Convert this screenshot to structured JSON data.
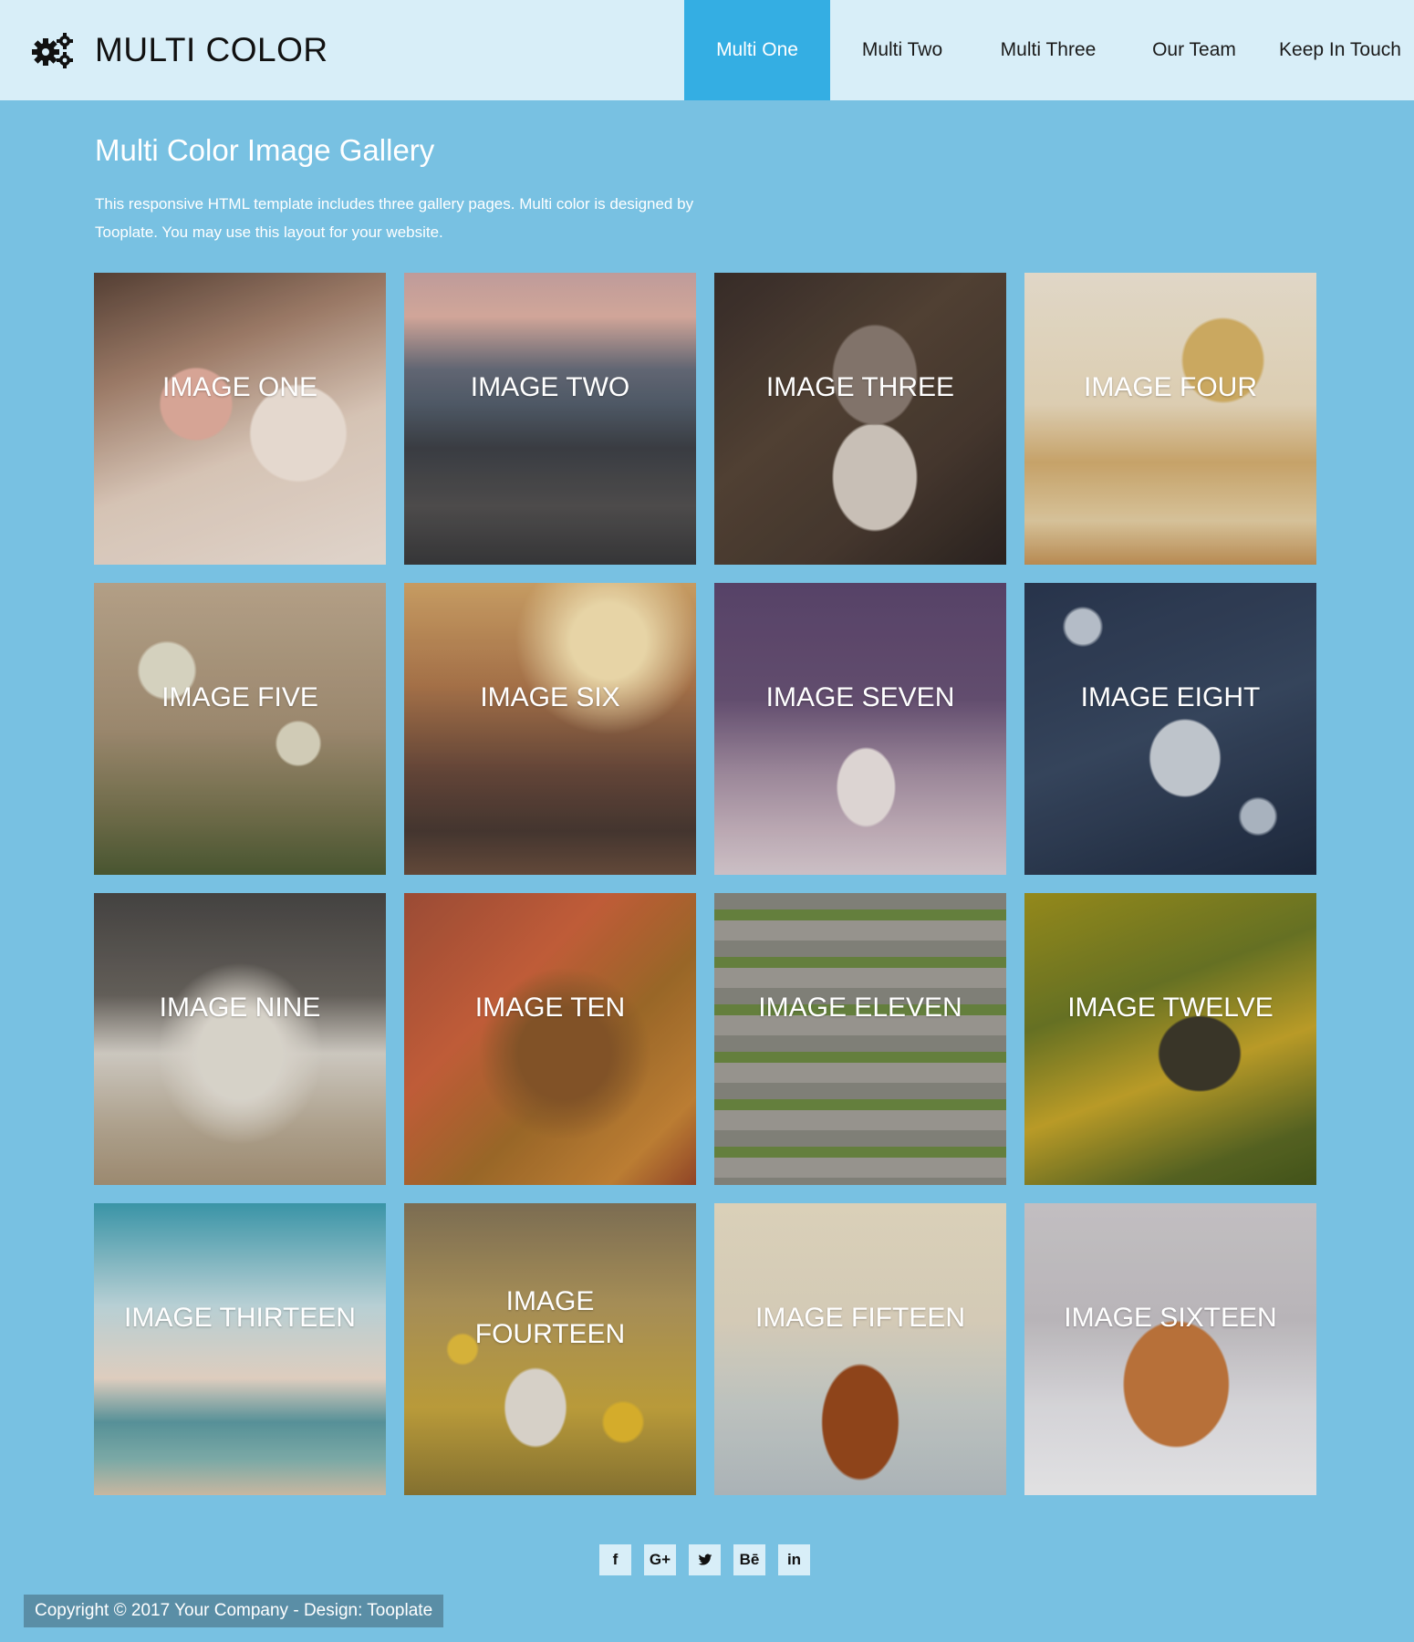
{
  "header": {
    "brand": "MULTI COLOR",
    "nav": [
      {
        "label": "Multi One",
        "active": true
      },
      {
        "label": "Multi Two",
        "active": false
      },
      {
        "label": "Multi Three",
        "active": false
      },
      {
        "label": "Our Team",
        "active": false
      },
      {
        "label": "Keep In Touch",
        "active": false
      }
    ],
    "active_color": "#34aee3"
  },
  "intro": {
    "title": "Multi Color Image Gallery",
    "text": "This responsive HTML template includes three gallery pages. Multi color is designed by Tooplate. You may use this layout for your website."
  },
  "gallery": {
    "tiles": [
      {
        "label": "IMAGE ONE"
      },
      {
        "label": "IMAGE TWO"
      },
      {
        "label": "IMAGE THREE"
      },
      {
        "label": "IMAGE FOUR"
      },
      {
        "label": "IMAGE FIVE"
      },
      {
        "label": "IMAGE SIX"
      },
      {
        "label": "IMAGE SEVEN"
      },
      {
        "label": "IMAGE EIGHT"
      },
      {
        "label": "IMAGE NINE"
      },
      {
        "label": "IMAGE TEN"
      },
      {
        "label": "IMAGE ELEVEN"
      },
      {
        "label": "IMAGE TWELVE"
      },
      {
        "label": "IMAGE THIRTEEN"
      },
      {
        "label": "IMAGE FOURTEEN"
      },
      {
        "label": "IMAGE FIFTEEN"
      },
      {
        "label": "IMAGE SIXTEEN"
      }
    ]
  },
  "social": {
    "icons": [
      {
        "name": "facebook-icon",
        "glyph": "f"
      },
      {
        "name": "google-plus-icon",
        "glyph": "G+"
      },
      {
        "name": "twitter-icon",
        "glyph": ""
      },
      {
        "name": "behance-icon",
        "glyph": "Bē"
      },
      {
        "name": "linkedin-icon",
        "glyph": "in"
      }
    ]
  },
  "footer": {
    "copyright": "Copyright © 2017 Your Company - Design: Tooplate"
  },
  "colors": {
    "page_background": "#78c1e2",
    "header_background": "#d8eef8"
  }
}
